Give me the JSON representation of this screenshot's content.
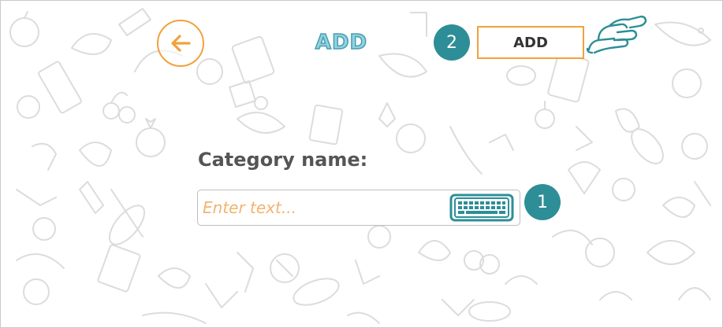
{
  "header": {
    "back_icon": "arrow-left-icon",
    "title": "ADD"
  },
  "toolbar": {
    "step_two": "2",
    "add_label": "ADD",
    "hand_icon": "pointing-hand-icon"
  },
  "form": {
    "label": "Category name:",
    "input_value": "",
    "input_placeholder": "Enter text...",
    "keyboard_icon": "keyboard-icon",
    "step_one": "1"
  },
  "colors": {
    "accent_orange": "#f0a23c",
    "teal": "#2d8e97",
    "title_fill": "#8fd3e0",
    "placeholder": "#f2b36f",
    "label": "#555555"
  }
}
